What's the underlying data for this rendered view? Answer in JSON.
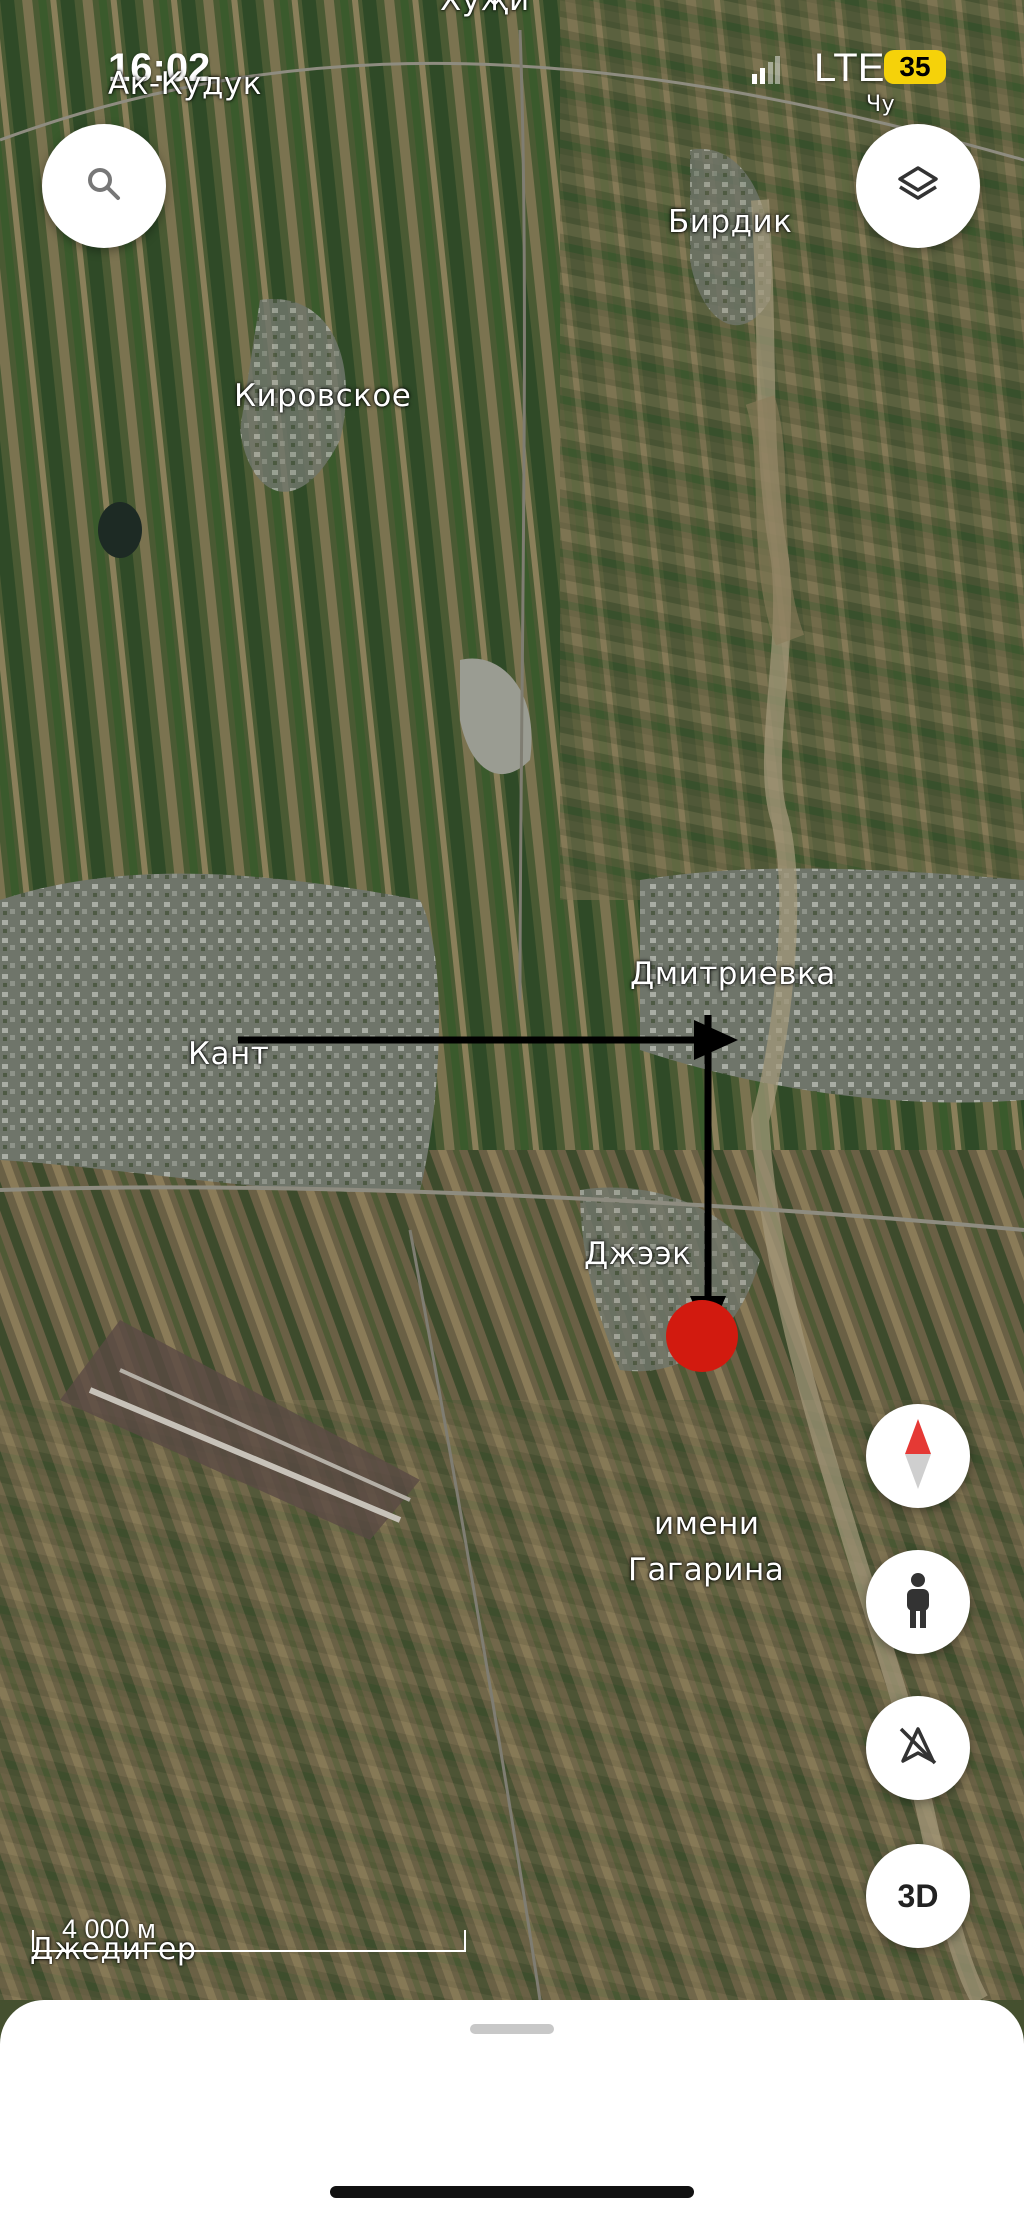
{
  "status_bar": {
    "time": "16:02",
    "network": "LTE",
    "battery": "35"
  },
  "places": {
    "ak_kuduk": "Ак-Кудук",
    "hunji_partial": "Хуҗи",
    "birdik": "Бирдик",
    "kirovskoe": "Кировское",
    "dmitrievka": "Дмитриевка",
    "kant": "Кант",
    "dzheek": "Джээк",
    "imeni": "имени",
    "gagarina": "Гагарина",
    "dzhediger": "Джедигер",
    "chu": "Чу"
  },
  "scale": {
    "label": "4 000 м"
  },
  "controls": {
    "search_icon": "search-icon",
    "layers_icon": "layers-icon",
    "compass_icon": "compass-icon",
    "streetview_icon": "pegman-icon",
    "location_icon": "location-off-icon",
    "threed_label": "3D"
  },
  "colors": {
    "marker": "#d21a0f",
    "arrow": "#000000",
    "sheet": "#ffffff"
  }
}
